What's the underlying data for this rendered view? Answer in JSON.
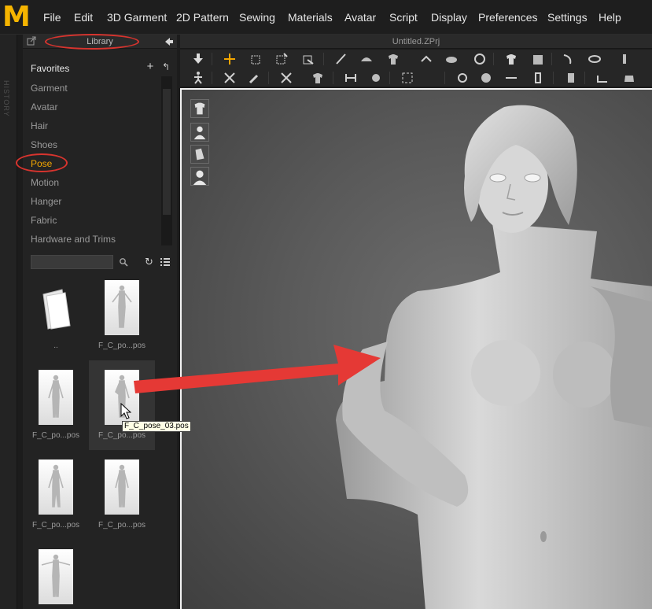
{
  "menu": [
    "File",
    "Edit",
    "3D Garment",
    "2D Pattern",
    "Sewing",
    "Materials",
    "Avatar",
    "Script",
    "Display",
    "Preferences",
    "Settings",
    "Help"
  ],
  "logo_letter": "M",
  "history_label": "HISTORY",
  "library": {
    "title": "Library",
    "categories": [
      "Favorites",
      "Garment",
      "Avatar",
      "Hair",
      "Shoes",
      "Pose",
      "Motion",
      "Hanger",
      "Fabric",
      "Hardware and Trims"
    ],
    "active_category": "Pose",
    "search_placeholder": "",
    "items": [
      {
        "label": "..",
        "type": "folder"
      },
      {
        "label": "F_C_po...pos",
        "type": "pose"
      },
      {
        "label": "F_C_po...pos",
        "type": "pose"
      },
      {
        "label": "F_C_po...pos",
        "type": "pose"
      },
      {
        "label": "F_C_po...pos",
        "type": "pose"
      },
      {
        "label": "F_C_po...pos",
        "type": "pose"
      },
      {
        "label": "",
        "type": "pose"
      }
    ],
    "tooltip": "F_C_pose_03.pos"
  },
  "document": {
    "title": "Untitled.ZPrj"
  },
  "colors": {
    "accent": "#f3a600",
    "annotation_red": "#d8342e",
    "logo": "#f5b400"
  },
  "viewport_buttons": [
    "garment-display-icon",
    "avatar-display-icon",
    "fabric-display-icon",
    "avatar-silhouette-icon"
  ]
}
